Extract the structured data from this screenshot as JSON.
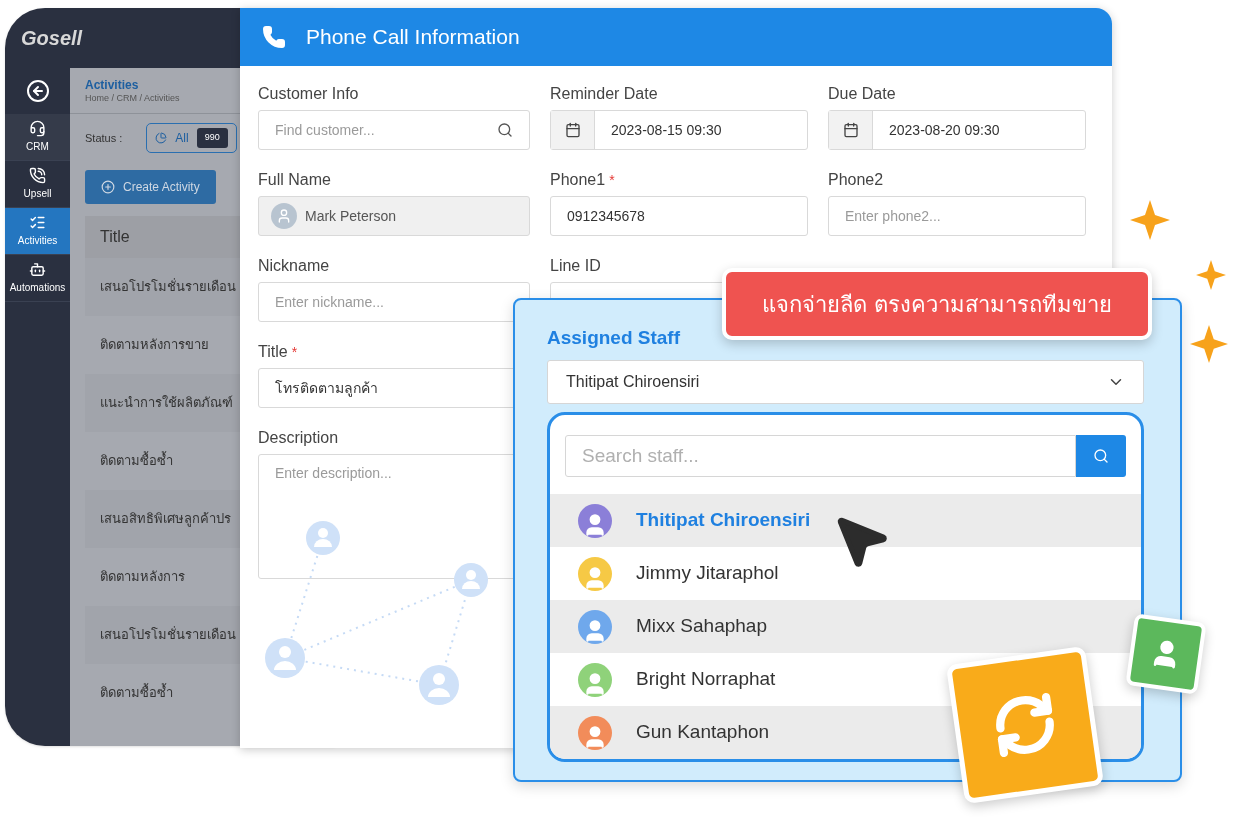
{
  "app": {
    "logo": "Gosell",
    "sidebar": [
      {
        "label": "CRM",
        "selected": false
      },
      {
        "label": "Upsell",
        "selected": false
      },
      {
        "label": "Activities",
        "selected": true
      },
      {
        "label": "Automations",
        "selected": false
      }
    ],
    "page_title": "Activities",
    "breadcrumb": "Home / CRM / Activities",
    "status_label": "Status :",
    "status_filter": {
      "label": "All",
      "count": "990"
    },
    "create_button": "Create Activity",
    "table": {
      "columns": [
        "Title"
      ],
      "rows": [
        "เสนอโปรโมชั่นรายเดือน",
        "ติดตามหลังการขาย",
        "แนะนำการใช้ผลิตภัณฑ์",
        "ติดตามซื้อซ้ำ",
        "เสนอสิทธิพิเศษลูกค้าปร",
        "ติดตามหลังการ",
        "เสนอโปรโมชั่นรายเดือน",
        "ติดตามซื้อซ้ำ"
      ]
    }
  },
  "dialog": {
    "title": "Phone Call Information",
    "rows": [
      [
        {
          "kind": "search",
          "label": "Customer Info",
          "placeholder": "Find customer..."
        },
        {
          "kind": "date",
          "label": "Reminder Date",
          "value": "2023-08-15 09:30"
        },
        {
          "kind": "date",
          "label": "Due Date",
          "value": "2023-08-20 09:30"
        }
      ],
      [
        {
          "kind": "person",
          "label": "Full Name",
          "value": "Mark Peterson",
          "disabled": true
        },
        {
          "kind": "text",
          "label": "Phone1",
          "required_mark": "*",
          "value": "0912345678"
        },
        {
          "kind": "text",
          "label": "Phone2",
          "placeholder": "Enter phone2..."
        }
      ],
      [
        {
          "kind": "text",
          "label": "Nickname",
          "placeholder": "Enter nickname..."
        },
        {
          "kind": "text",
          "label": "Line ID"
        }
      ],
      [
        {
          "kind": "text",
          "label": "Title",
          "required_mark": "*",
          "value": "โทรติดตามลูกค้า"
        }
      ],
      [
        {
          "kind": "textarea",
          "label": "Description",
          "placeholder": "Enter description..."
        }
      ]
    ]
  },
  "staff_panel": {
    "title": "Assigned Staff",
    "selected_staff": "Thitipat Chiroensiri",
    "search_placeholder": "Search staff...",
    "staff": [
      {
        "name": "Thitipat Chiroensiri",
        "selected": true,
        "color": "#8b7fd8"
      },
      {
        "name": "Jimmy Jitaraphol",
        "selected": false,
        "color": "#f6c945"
      },
      {
        "name": "Mixx Sahaphap",
        "selected": false,
        "color": "#6fa8ec"
      },
      {
        "name": "Bright Norraphat",
        "selected": false,
        "color": "#8fd27a"
      },
      {
        "name": "Gun Kantaphon",
        "selected": false,
        "color": "#f28c5a"
      }
    ]
  },
  "banner": "แจกจ่ายลีด ตรงความสามารถทีมขาย"
}
